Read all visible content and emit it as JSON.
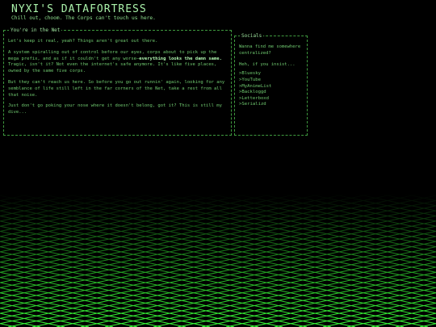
{
  "site": {
    "title": "NYXI'S DATAFORTRESS",
    "tagline": "Chill out, choom. The Corps can't touch us here."
  },
  "main": {
    "legend": "You're in the Net",
    "p1": "Let's keep it real, yeah? Things aren't great out there.",
    "p2_pre": "A system spiralling out of control before our eyes, corps about to pick up the mega prefix, and as if it couldn't get any worse—",
    "p2_bold": "everything looks the damn same.",
    "p2_post": " Tragic, isn't it? Not even the internet's safe anymore. It's like five places, owned by the same five corps.",
    "p3": "But they can't reach us here. So before you go out runnin' again, looking for any semblance of life still left in the far corners of the Net, take a rest from all that noise.",
    "p4": "Just don't go poking your nose where it doesn't belong, got it? This is still my dive..."
  },
  "side": {
    "legend": "Socials",
    "intro": "Wanna find me somewhere centralized?",
    "insist": "Heh, if you insist...",
    "links": [
      ">Bluesky",
      ">YouTube",
      ">MyAnimeList",
      ">Backloggd",
      ">Letterboxd",
      ">Serializd"
    ]
  },
  "colors": {
    "accent": "#7fdc7f",
    "grid": "#39ff39",
    "background": "#000000"
  }
}
